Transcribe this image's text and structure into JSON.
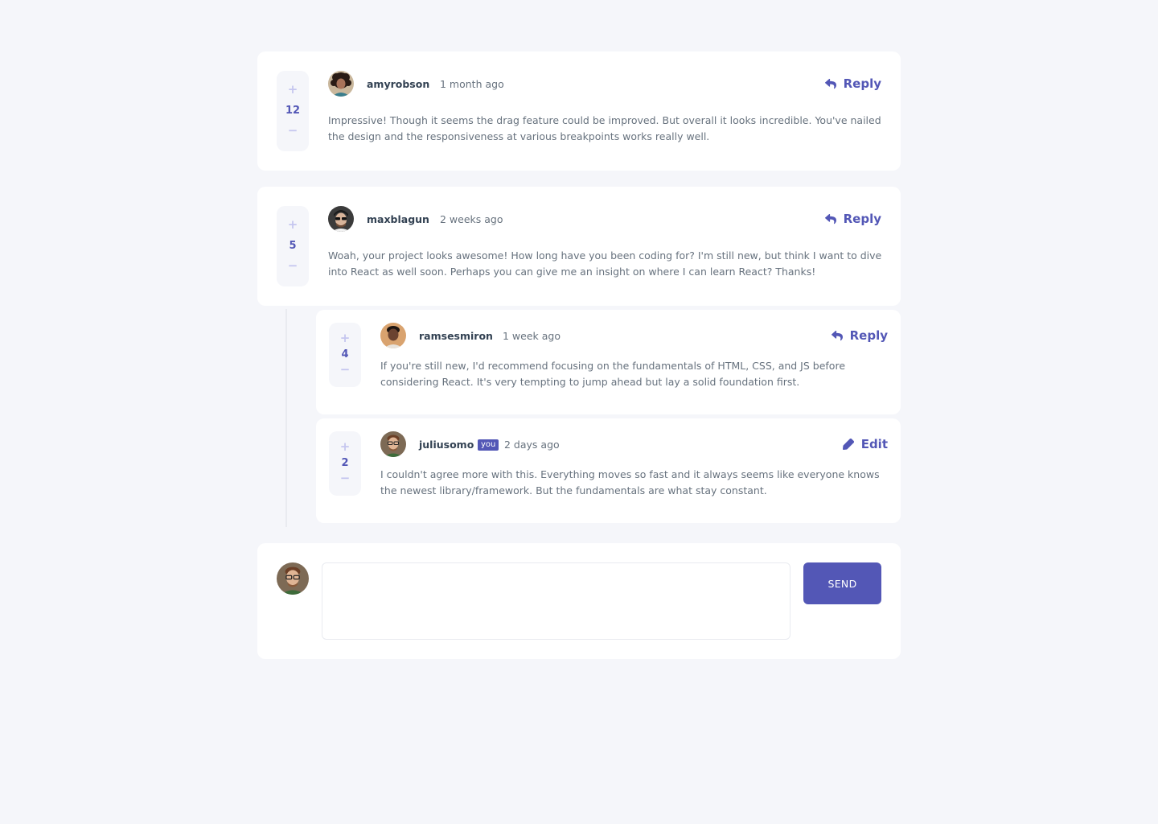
{
  "comments": [
    {
      "score": "12",
      "username": "amyrobson",
      "created": "1 month ago",
      "action": "Reply",
      "content": "Impressive! Though it seems the drag feature could be improved. But overall it looks incredible. You've nailed the design and the responsiveness at various breakpoints works really well."
    },
    {
      "score": "5",
      "username": "maxblagun",
      "created": "2 weeks ago",
      "action": "Reply",
      "content": "Woah, your project looks awesome! How long have you been coding for? I'm still new, but think I want to dive into React as well soon. Perhaps you can give me an insight on where I can learn React? Thanks!"
    }
  ],
  "replies": [
    {
      "score": "4",
      "username": "ramsesmiron",
      "created": "1 week ago",
      "action": "Reply",
      "content": "If you're still new, I'd recommend focusing on the fundamentals of HTML, CSS, and JS before considering React. It's very tempting to jump ahead but lay a solid foundation first."
    },
    {
      "score": "2",
      "username": "juliusomo",
      "you_badge": "you",
      "created": "2 days ago",
      "action": "Edit",
      "content": "I couldn't agree more with this. Everything moves so fast and it always seems like everyone knows the newest library/framework. But the fundamentals are what stay constant."
    }
  ],
  "vote": {
    "plus": "+",
    "minus": "−"
  },
  "composer": {
    "placeholder": "",
    "send_label": "SEND"
  },
  "colors": {
    "accent": "#5357b6",
    "accent_light": "#c5c6ef",
    "background": "#f5f6fa",
    "card": "#ffffff",
    "heading": "#334253",
    "text": "#67727e"
  },
  "icons": {
    "reply": "reply-icon",
    "edit": "edit-icon",
    "avatar_amyrobson": "avatar-amyrobson",
    "avatar_maxblagun": "avatar-maxblagun",
    "avatar_ramsesmiron": "avatar-ramsesmiron",
    "avatar_juliusomo": "avatar-juliusomo"
  }
}
